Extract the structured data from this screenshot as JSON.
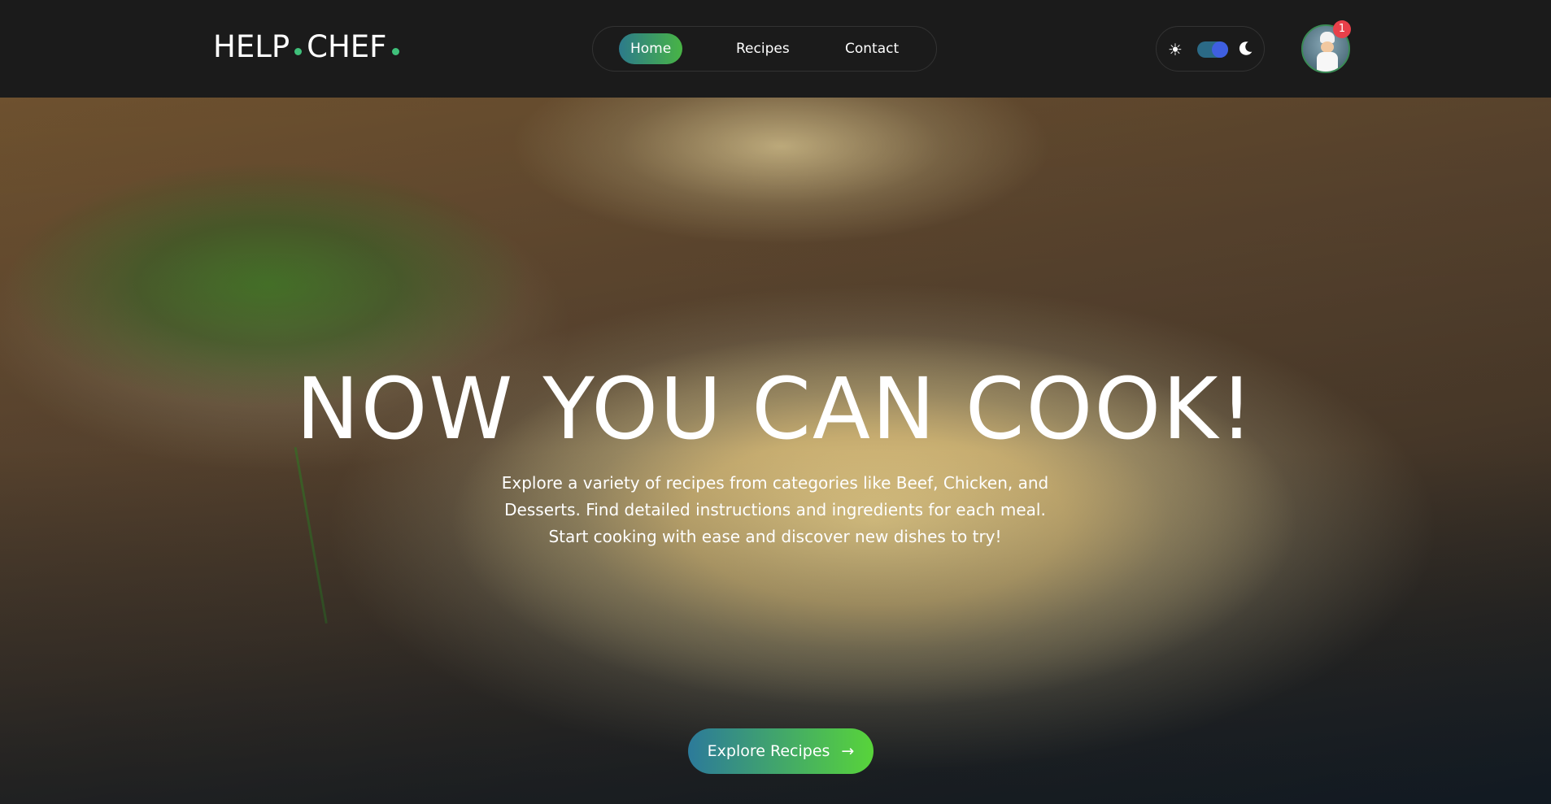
{
  "header": {
    "logo": {
      "part1": "HELP",
      "part2": "CHEF"
    },
    "nav": [
      {
        "label": "Home",
        "active": true
      },
      {
        "label": "Recipes",
        "active": false
      },
      {
        "label": "Contact",
        "active": false
      }
    ],
    "theme_toggle": {
      "light_icon": "sun-icon",
      "dark_icon": "moon-icon",
      "mode": "dark"
    },
    "avatar": {
      "notification_count": "1"
    }
  },
  "hero": {
    "title": "NOW YOU CAN COOK!",
    "description": "Explore a variety of recipes from categories like Beef, Chicken, and Desserts. Find detailed instructions and ingredients for each meal. Start cooking with ease and discover new dishes to try!",
    "cta_label": "Explore Recipes",
    "cta_icon": "arrow-right-icon"
  },
  "colors": {
    "accent_green": "#48b445",
    "accent_teal": "#2c7a8b",
    "header_bg": "#1b1b1b",
    "badge_red": "#e8404a"
  }
}
